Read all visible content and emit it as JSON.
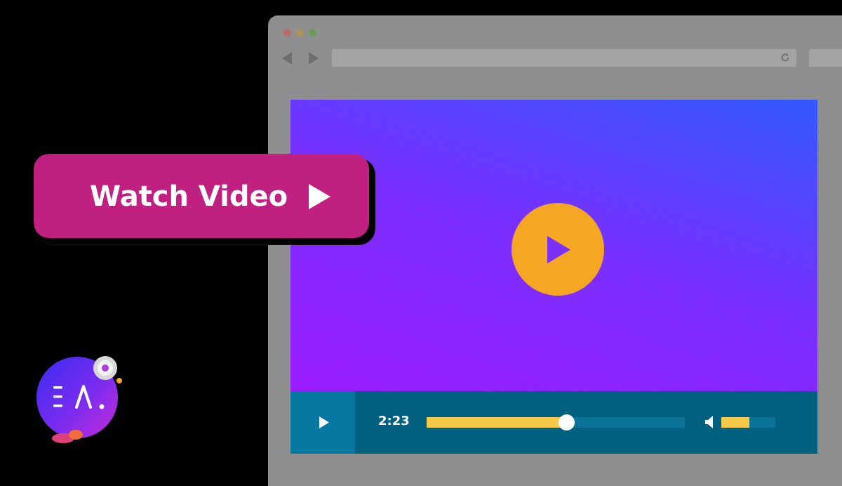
{
  "cta": {
    "label": "Watch Video",
    "icon": "play-icon",
    "color": "#c0207f"
  },
  "browser": {
    "window_controls": [
      "close",
      "minimize",
      "maximize"
    ],
    "icons": [
      "back-arrow-icon",
      "forward-arrow-icon",
      "reload-icon"
    ]
  },
  "player": {
    "big_play_icon": "play-icon",
    "big_play_color": "#f5a623",
    "control_play_icon": "play-icon",
    "time": "2:23",
    "progress": 0.54,
    "volume": 0.52,
    "volume_icon": "speaker-icon",
    "accent": "#f7c948",
    "control_bar_color": "#00607f"
  },
  "logo": {
    "text": "EA",
    "icon": "essential-addons-logo"
  }
}
